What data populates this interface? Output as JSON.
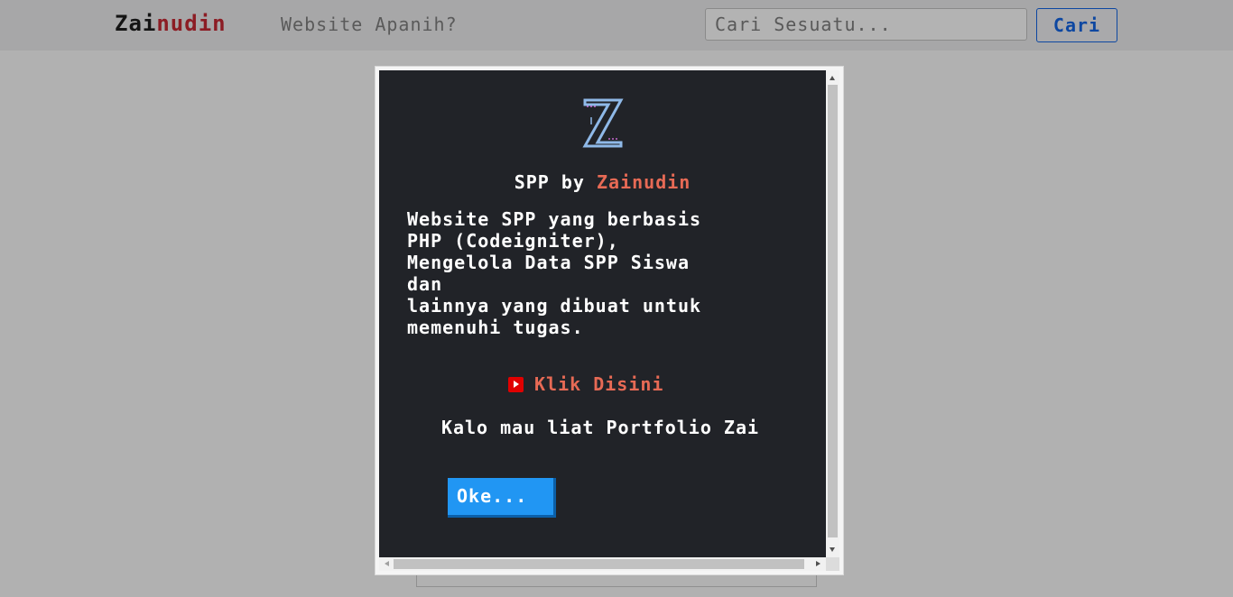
{
  "navbar": {
    "brand_part1": "Zai",
    "brand_part2": "nudin",
    "nav_link": "Website Apanih?",
    "search_placeholder": "Cari Sesuatu...",
    "search_button": "Cari"
  },
  "modal": {
    "logo_icon": "z-logo-icon",
    "title_prefix": "SPP by ",
    "title_accent": "Zainudin",
    "description": "Website SPP yang berbasis\nPHP (Codeigniter),\nMengelola Data SPP Siswa\ndan\nlainnya yang dibuat untuk\nmemenuhi tugas.",
    "link_icon": "youtube-icon",
    "link_text": "Klik Disini",
    "note": "Kalo mau liat Portfolio Zai",
    "ok_button": "Oke..."
  },
  "colors": {
    "brand_dark": "#141414",
    "brand_red": "#8c1c24",
    "accent": "#e76a55",
    "button_blue": "#2196f3",
    "modal_bg": "#212328"
  }
}
